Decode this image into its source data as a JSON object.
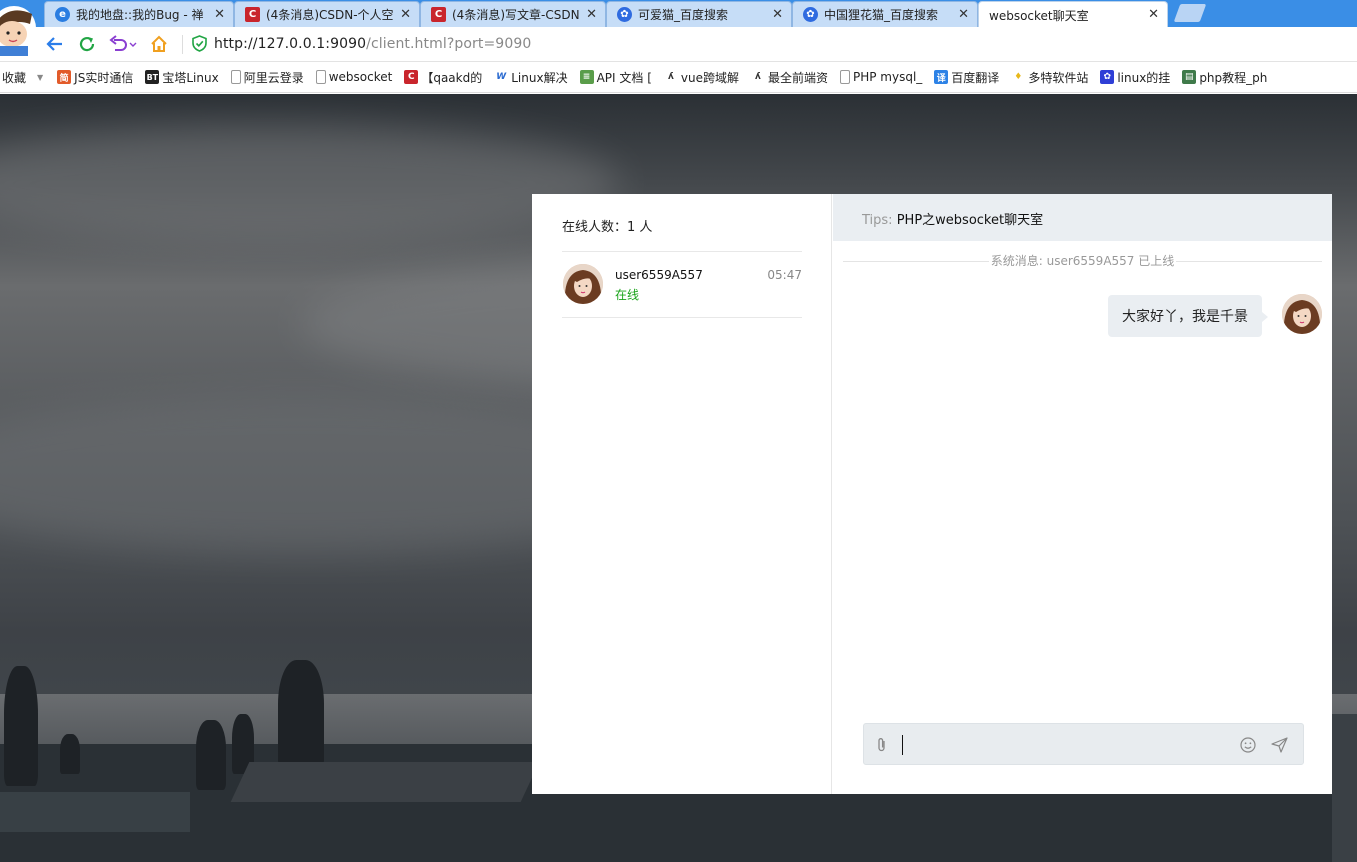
{
  "browser": {
    "tabs": [
      {
        "title": "我的地盘::我的Bug - 禅",
        "icon": "ie-globe-icon",
        "active": false
      },
      {
        "title": "(4条消息)CSDN-个人空",
        "icon": "csdn-icon",
        "active": false
      },
      {
        "title": "(4条消息)写文章-CSDN",
        "icon": "csdn-icon",
        "active": false
      },
      {
        "title": "可爱猫_百度搜索",
        "icon": "baidu-paw-icon",
        "active": false
      },
      {
        "title": "中国狸花猫_百度搜索",
        "icon": "baidu-paw-icon",
        "active": false
      },
      {
        "title": "websocket聊天室",
        "icon": "page-icon",
        "active": true
      }
    ],
    "tab_close": "✕",
    "url_host": "http://127.0.0.1:9090",
    "url_path": "/client.html?port=9090",
    "bookmarks": [
      {
        "label": "收藏",
        "icon": ""
      },
      {
        "label": "JS实时通信",
        "icon": "jian-icon"
      },
      {
        "label": "宝塔Linux",
        "icon": "bt-icon"
      },
      {
        "label": "阿里云登录",
        "icon": "page-icon"
      },
      {
        "label": "websocket",
        "icon": "page-icon"
      },
      {
        "label": "【qaakd的",
        "icon": "csdn-icon"
      },
      {
        "label": "Linux解决",
        "icon": "wp-icon"
      },
      {
        "label": "API 文档 [",
        "icon": "doc-icon"
      },
      {
        "label": "vue跨域解",
        "icon": "segment-icon"
      },
      {
        "label": "最全前端资",
        "icon": "segment-icon"
      },
      {
        "label": "PHP mysql_",
        "icon": "page-icon"
      },
      {
        "label": "百度翻译",
        "icon": "fanyi-icon"
      },
      {
        "label": "多特软件站",
        "icon": "duote-icon"
      },
      {
        "label": "linux的挂",
        "icon": "baidu-paw-icon"
      },
      {
        "label": "php教程_ph",
        "icon": "php-icon"
      }
    ],
    "colors": {
      "tabbar": "#3a8ee6",
      "active_tab": "#ffffff"
    }
  },
  "chat": {
    "online_label": "在线人数：1 人",
    "users": [
      {
        "name": "user6559A557",
        "status": "在线",
        "time": "05:47"
      }
    ],
    "tips_label": "Tips:",
    "tips_text": "PHP之websocket聊天室",
    "system_message": "系统消息: user6559A557 已上线",
    "messages": [
      {
        "text": "大家好丫，我是千景",
        "side": "right"
      }
    ],
    "input_value": "",
    "colors": {
      "status_online": "#1aa31a",
      "header_bg": "#eaeef2",
      "bubble_bg": "#eaeef2"
    }
  }
}
